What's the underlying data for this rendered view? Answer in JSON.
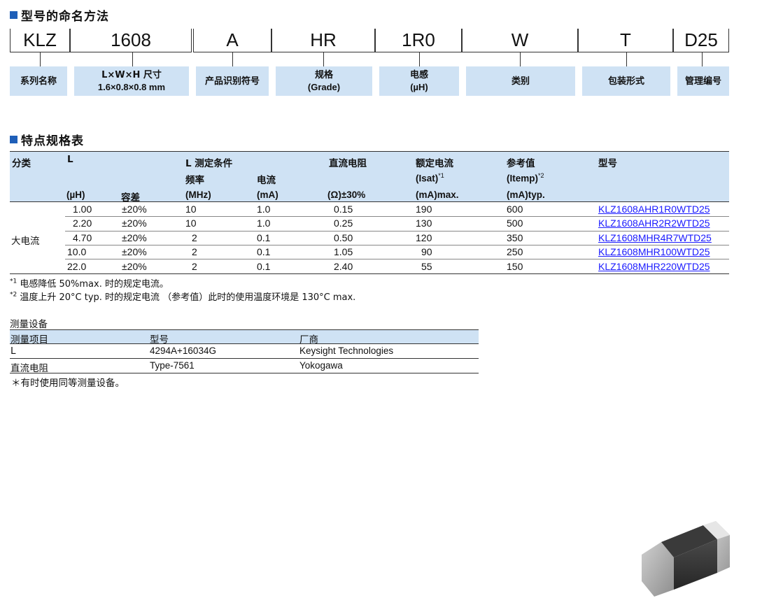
{
  "naming": {
    "title": "型号的命名方法",
    "codes": [
      "KLZ",
      "1608",
      "A",
      "HR",
      "1R0",
      "W",
      "T",
      "D25"
    ],
    "labels": [
      {
        "l1": "系列名称",
        "l2": ""
      },
      {
        "l1": "L×W×H 尺寸",
        "l2": "1.6×0.8×0.8 mm"
      },
      {
        "l1": "产品识别符号",
        "l2": ""
      },
      {
        "l1": "规格",
        "l2": "(Grade)"
      },
      {
        "l1": "电感",
        "l2": "(µH)"
      },
      {
        "l1": "类别",
        "l2": ""
      },
      {
        "l1": "包装形式",
        "l2": ""
      },
      {
        "l1": "管理编号",
        "l2": ""
      }
    ]
  },
  "specs": {
    "title": "特点规格表",
    "headers": {
      "category": "分类",
      "L": "L",
      "L_unit": "(µH)",
      "tolerance": "容差",
      "test_cond": "L 测定条件",
      "freq": "频率",
      "freq_unit": "(MHz)",
      "current": "电流",
      "current_unit": "(mA)",
      "dcr": "直流电阻",
      "dcr_unit": "(Ω)±30%",
      "isat": "额定电流",
      "isat_sym": "(Isat)",
      "isat_sup": "*1",
      "isat_unit": "(mA)max.",
      "itemp": "参考值",
      "itemp_sym": "(Itemp)",
      "itemp_sup": "*2",
      "itemp_unit": "(mA)typ.",
      "part": "型号"
    },
    "category": "大电流",
    "rows": [
      {
        "L": "1.00",
        "tol": "±20%",
        "freq": "10",
        "cur": "1.0",
        "dcr": "0.15",
        "isat": "190",
        "itemp": "600",
        "part": "KLZ1608AHR1R0WTD25"
      },
      {
        "L": "2.20",
        "tol": "±20%",
        "freq": "10",
        "cur": "1.0",
        "dcr": "0.25",
        "isat": "130",
        "itemp": "500",
        "part": "KLZ1608AHR2R2WTD25"
      },
      {
        "L": "4.70",
        "tol": "±20%",
        "freq": "2",
        "cur": "0.1",
        "dcr": "0.50",
        "isat": "120",
        "itemp": "350",
        "part": "KLZ1608MHR4R7WTD25"
      },
      {
        "L": "10.0",
        "tol": "±20%",
        "freq": "2",
        "cur": "0.1",
        "dcr": "1.05",
        "isat": "90",
        "itemp": "250",
        "part": "KLZ1608MHR100WTD25"
      },
      {
        "L": "22.0",
        "tol": "±20%",
        "freq": "2",
        "cur": "0.1",
        "dcr": "2.40",
        "isat": "55",
        "itemp": "150",
        "part": "KLZ1608MHR220WTD25"
      }
    ],
    "notes": [
      {
        "sup": "*1",
        "text": " 电感降低 50%max. 时的规定电流。"
      },
      {
        "sup": "*2",
        "text": " 温度上升 20°C typ. 时的规定电流 （参考值）此时的使用温度环境是 130°C max."
      }
    ]
  },
  "measurement": {
    "title": "测量设备",
    "headers": [
      "测量项目",
      "型号",
      "厂商"
    ],
    "rows": [
      [
        "L",
        "4294A+16034G",
        "Keysight Technologies"
      ],
      [
        "直流电阻",
        "Type-7561",
        "Yokogawa"
      ]
    ],
    "footnote": "＊有时使用同等测量设备。"
  },
  "colors": {
    "accent": "#1f5fb8",
    "header_bg": "#cfe2f4",
    "link": "#1a1aff"
  }
}
